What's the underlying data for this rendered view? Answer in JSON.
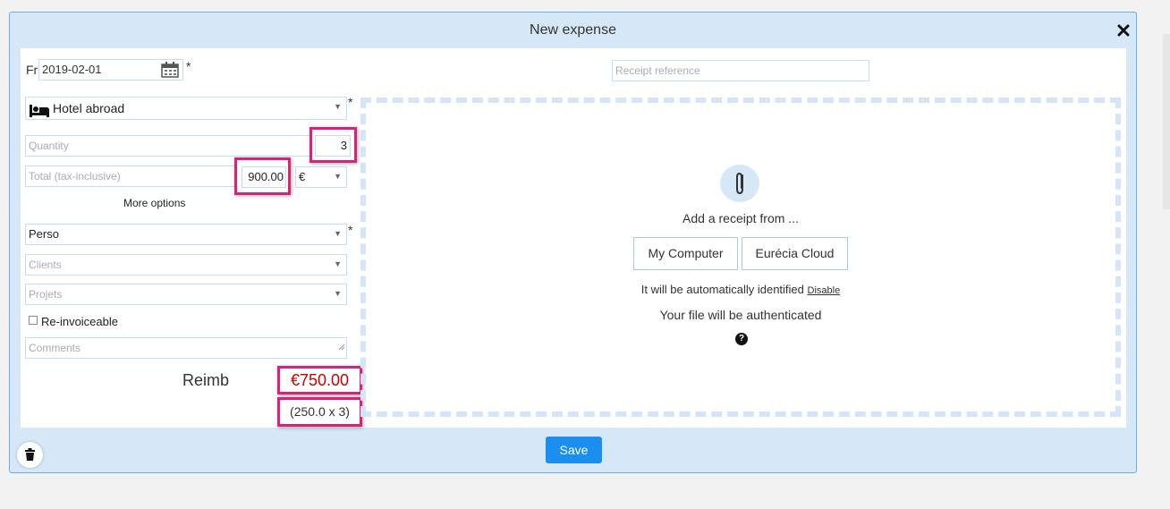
{
  "dialog": {
    "title": "New expense",
    "close_label": "✕"
  },
  "date": {
    "day_label": "Fri",
    "value": "2019-02-01",
    "required_mark": "*"
  },
  "receipt_reference": {
    "placeholder": "Receipt reference"
  },
  "category": {
    "value": "Hotel abroad",
    "required_mark": "*"
  },
  "quantity": {
    "placeholder": "Quantity",
    "value": "3"
  },
  "total": {
    "placeholder": "Total (tax-inclusive)",
    "value": "900.00",
    "currency": "€"
  },
  "more_options_label": "More options",
  "account": {
    "value": "Perso",
    "required_mark": "*"
  },
  "clients": {
    "placeholder": "Clients"
  },
  "projects": {
    "placeholder": "Projets"
  },
  "reinvoiceable": {
    "label": "Re-invoiceable",
    "checked": false
  },
  "comments": {
    "placeholder": "Comments"
  },
  "reimb": {
    "label": "Reimb",
    "amount": "€750.00",
    "detail": "(250.0 x 3)"
  },
  "receipt_upload": {
    "prompt": "Add a receipt from ...",
    "my_computer_label": "My Computer",
    "cloud_label": "Eurécia Cloud",
    "auto_identify_text": "It will be automatically identified",
    "disable_link": "Disable",
    "authenticated_text": "Your file will be authenticated",
    "help_label": "?"
  },
  "save_label": "Save",
  "colors": {
    "accent": "#1a8ff0",
    "highlight": "#d6247c",
    "reimb_amount": "#cc0000",
    "dialog_bg": "#d6e8f8"
  }
}
